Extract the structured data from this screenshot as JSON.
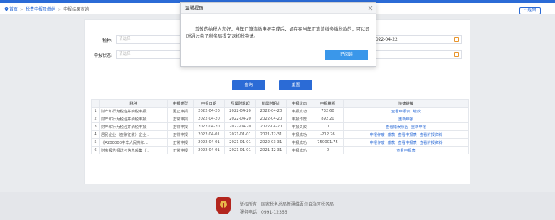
{
  "breadcrumb": {
    "home": "首页",
    "level2": "税费申报及缴纳",
    "level3": "申报结果查询"
  },
  "back_label": "返回",
  "form": {
    "tax_type_label": "税种:",
    "tax_type_placeholder": "请选择",
    "status_label": "申报状态:",
    "status_placeholder": "请选择",
    "date_value": "2022-04-22",
    "query_label": "查询",
    "reset_label": "重置"
  },
  "table": {
    "headers": [
      "",
      "税种",
      "申报类型",
      "申报日期",
      "所属时期起",
      "所属时期止",
      "申报状态",
      "申报税额",
      "快捷链接"
    ],
    "rows": [
      {
        "no": "1",
        "name": "财产和行为税合并纳税申报",
        "type": "更正申报",
        "date": "2022-04-20",
        "start": "2022-04-20",
        "end": "2022-04-20",
        "status": "申报成功",
        "amount": "732.60",
        "links": [
          "查看申报表",
          "缴款"
        ]
      },
      {
        "no": "2",
        "name": "财产和行为税合并纳税申报",
        "type": "正常申报",
        "date": "2022-04-20",
        "start": "2022-04-20",
        "end": "2022-04-20",
        "status": "申报作废",
        "amount": "892.20",
        "links": [
          "重新申报"
        ]
      },
      {
        "no": "3",
        "name": "财产和行为税合并纳税申报",
        "type": "正常申报",
        "date": "2022-04-20",
        "start": "2022-04-20",
        "end": "2022-04-20",
        "status": "申报失败",
        "amount": "0",
        "links": [
          "查看错误原因",
          "重新申报"
        ]
      },
      {
        "no": "4",
        "name": "居民企业（查账征收）企业...",
        "type": "正常申报",
        "date": "2022-04-01",
        "start": "2021-01-01",
        "end": "2021-12-31",
        "status": "申报成功",
        "amount": "-212.26",
        "links": [
          "申报作废",
          "缴款",
          "查看申报表",
          "查看附报资料"
        ]
      },
      {
        "no": "5",
        "name": "《A200000中华人民共和...",
        "type": "正常申报",
        "date": "2022-04-01",
        "start": "2021-01-01",
        "end": "2022-03-31",
        "status": "申报成功",
        "amount": "750001.75",
        "links": [
          "申报作废",
          "缴款",
          "查看申报表",
          "查看附报资料"
        ]
      },
      {
        "no": "6",
        "name": "财务报告报送与信息采集（...",
        "type": "正常申报",
        "date": "2022-04-01",
        "start": "2021-01-01",
        "end": "2021-12-31",
        "status": "申报成功",
        "amount": "0",
        "links": [
          "查看申报表"
        ]
      }
    ]
  },
  "footer": {
    "copyright": "版权所有：国家税务总局新疆维吾尔自治区税务局",
    "phone": "服务电话：0991-12366"
  },
  "dialog": {
    "title": "温馨提醒",
    "message": "尊敬的纳税人您好，当年汇算清缴申报完成后，如存在当年汇算清缴多缴税款的，可以即时通过电子税务局提交退抵税申请。",
    "confirm_label": "已阅读"
  },
  "colors": {
    "primary": "#2b6bd6",
    "dialog_button": "#3a97ea",
    "calendar_icon": "#e8952d",
    "logo": "#b3261e"
  }
}
